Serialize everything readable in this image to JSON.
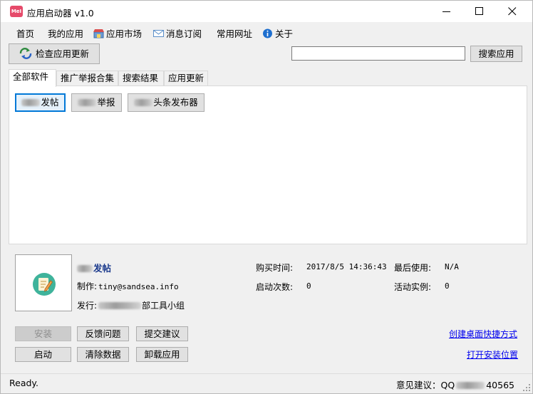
{
  "window": {
    "logo_text": "MeI",
    "title": "应用启动器 v1.0"
  },
  "menu": [
    {
      "label": "首页"
    },
    {
      "label": "我的应用"
    },
    {
      "label": "应用市场"
    },
    {
      "label": "消息订阅"
    },
    {
      "label": "常用网址"
    },
    {
      "label": "关于"
    }
  ],
  "toolbar": {
    "check_update_label": "检查应用更新",
    "search_value": "",
    "search_button_label": "搜索应用"
  },
  "tabs": [
    {
      "label": "全部软件",
      "active": true
    },
    {
      "label": "推广举报合集",
      "active": false
    },
    {
      "label": "搜索结果",
      "active": false
    },
    {
      "label": "应用更新",
      "active": false
    }
  ],
  "software": [
    {
      "label": "发帖",
      "selected": true
    },
    {
      "label": "举报",
      "selected": false
    },
    {
      "label": "头条发布器",
      "selected": false
    }
  ],
  "detail": {
    "name": "发帖",
    "author_label": "制作:",
    "author_value": "tiny@sandsea.info",
    "publisher_label": "发行:",
    "publisher_value": "部工具小组",
    "purchase_label": "购买时间:",
    "purchase_value": "2017/8/5 14:36:43",
    "launch_label": "启动次数:",
    "launch_value": "0",
    "last_used_label": "最后使用:",
    "last_used_value": "N/A",
    "instances_label": "活动实例:",
    "instances_value": "0"
  },
  "actions": {
    "install": "安装",
    "feedback": "反馈问题",
    "suggest": "提交建议",
    "launch": "启动",
    "clear_data": "清除数据",
    "uninstall": "卸载应用",
    "create_shortcut": "创建桌面快捷方式",
    "open_location": "打开安装位置"
  },
  "status": {
    "text": "Ready.",
    "contact_label": "意见建议：QQ",
    "contact_value": "40565"
  },
  "colors": {
    "accent": "#0078d7",
    "link": "#0000ee",
    "app_name": "#1b3a8c",
    "logo": "#e64a6a"
  }
}
